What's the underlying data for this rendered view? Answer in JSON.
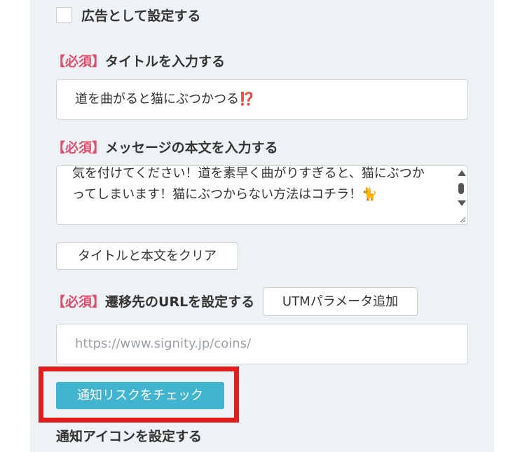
{
  "ad_checkbox": {
    "label": "広告として設定する",
    "checked": false
  },
  "title_field": {
    "required_tag": "【必須】",
    "label": "タイトルを入力する",
    "value": "道を曲がると猫にぶつかつる⁉️"
  },
  "message_field": {
    "required_tag": "【必須】",
    "label": "メッセージの本文を入力する",
    "value": "気を付けてください！道を素早く曲がりすぎると、猫にぶつかってしまいます！猫にぶつからない方法はコチラ！🐈"
  },
  "clear_button": {
    "label": "タイトルと本文をクリア"
  },
  "url_field": {
    "required_tag": "【必須】",
    "label": "遷移先のURLを設定する",
    "utm_button_label": "UTMパラメータ追加",
    "placeholder": "https://www.signity.jp/coins/",
    "value": ""
  },
  "check_button": {
    "label": "通知リスクをチェック"
  },
  "icon_section": {
    "label": "通知アイコンを設定する"
  },
  "colors": {
    "required": "#e0506e",
    "primary_button": "#41b4d0",
    "highlight": "#e01e1e",
    "panel_bg": "#eef2f5"
  },
  "icons": {
    "scroll_up": "triangle-up",
    "scroll_down": "triangle-down",
    "resize": "resize-grip"
  }
}
